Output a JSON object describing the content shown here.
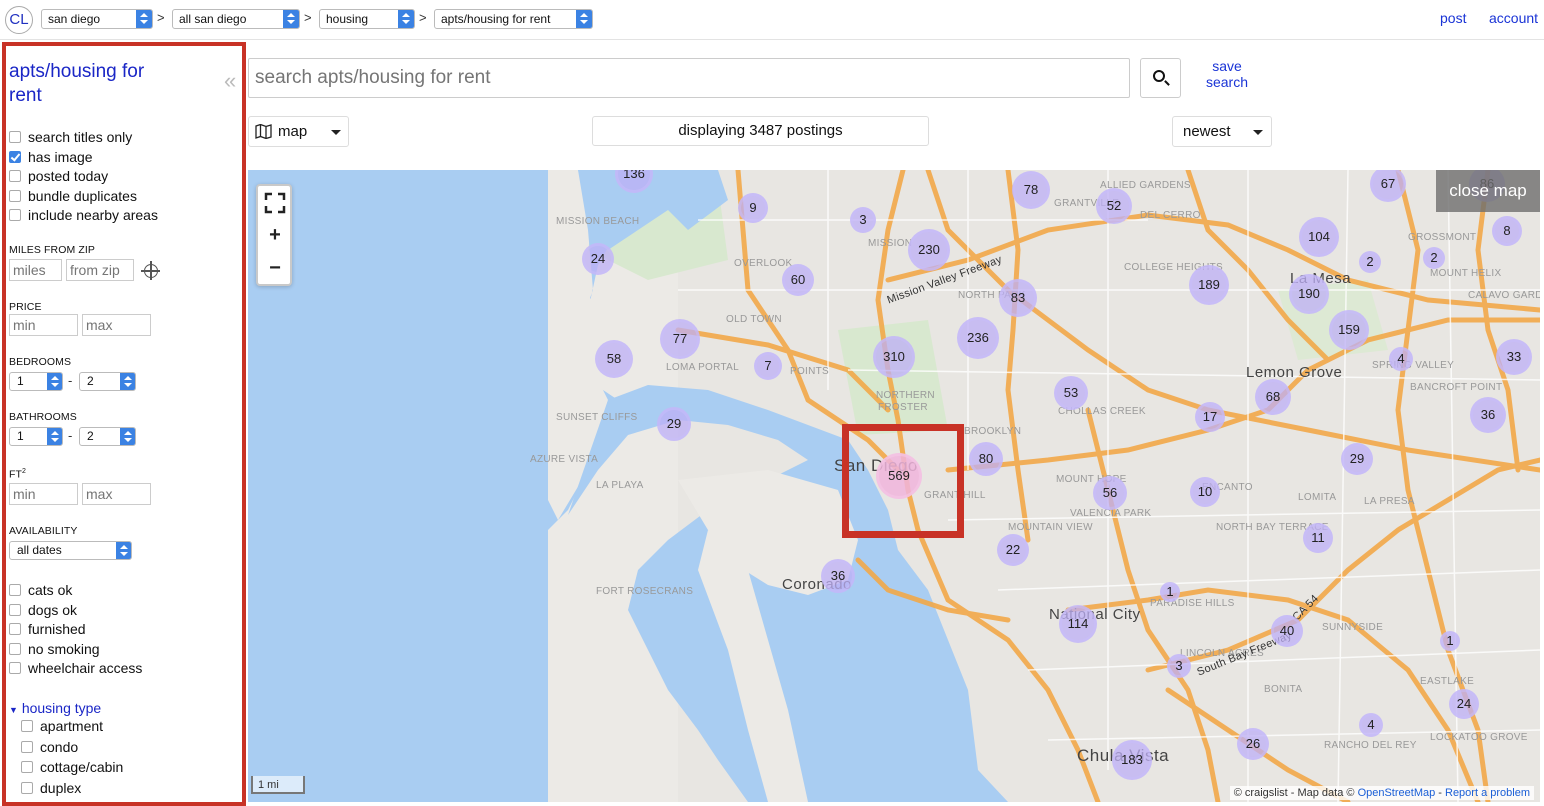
{
  "topbar": {
    "logo": "CL",
    "breadcrumbs": [
      "san diego",
      "all san diego",
      "housing",
      "apts/housing for rent"
    ],
    "separator": ">",
    "post_link": "post",
    "account_link": "account"
  },
  "sidebar": {
    "title": "apts/housing for rent",
    "collapse_glyph": "«",
    "options": [
      {
        "label": "search titles only",
        "checked": false
      },
      {
        "label": "has image",
        "checked": true
      },
      {
        "label": "posted today",
        "checked": false
      },
      {
        "label": "bundle duplicates",
        "checked": false
      },
      {
        "label": "include nearby areas",
        "checked": false
      }
    ],
    "miles_from_zip": {
      "label": "MILES FROM ZIP",
      "miles_placeholder": "miles",
      "zip_placeholder": "from zip"
    },
    "price": {
      "label": "PRICE",
      "min_placeholder": "min",
      "max_placeholder": "max"
    },
    "bedrooms": {
      "label": "BEDROOMS",
      "min": "1",
      "max": "2"
    },
    "bathrooms": {
      "label": "BATHROOMS",
      "min": "1",
      "max": "2"
    },
    "sqft": {
      "label": "FT",
      "sup": "2",
      "min_placeholder": "min",
      "max_placeholder": "max"
    },
    "availability": {
      "label": "AVAILABILITY",
      "value": "all dates"
    },
    "range_dash": "-",
    "amenities": [
      {
        "label": "cats ok",
        "checked": false
      },
      {
        "label": "dogs ok",
        "checked": false
      },
      {
        "label": "furnished",
        "checked": false
      },
      {
        "label": "no smoking",
        "checked": false
      },
      {
        "label": "wheelchair access",
        "checked": false
      }
    ],
    "housing_type": {
      "label": "housing type",
      "items": [
        "apartment",
        "condo",
        "cottage/cabin",
        "duplex"
      ]
    }
  },
  "search": {
    "placeholder": "search apts/housing for rent",
    "save_line1": "save",
    "save_line2": "search"
  },
  "toolbar": {
    "view_mode": "map",
    "postings_text": "displaying 3487 postings",
    "sort": "newest"
  },
  "map": {
    "close_label": "close map",
    "zoom_in": "+",
    "zoom_out": "−",
    "scale": "1 mi",
    "attribution_prefix": "© craigslist - Map data ©",
    "attribution_osm": "OpenStreetMap",
    "attribution_sep": " - ",
    "attribution_report": "Report a problem",
    "clusters": [
      {
        "label": "136",
        "hot": false
      },
      {
        "label": "9",
        "hot": false
      },
      {
        "label": "3",
        "hot": false
      },
      {
        "label": "78",
        "hot": false
      },
      {
        "label": "52",
        "hot": false
      },
      {
        "label": "67",
        "hot": false
      },
      {
        "label": "8",
        "hot": false
      },
      {
        "label": "24",
        "hot": false
      },
      {
        "label": "230",
        "hot": false
      },
      {
        "label": "104",
        "hot": false
      },
      {
        "label": "2",
        "hot": false
      },
      {
        "label": "2",
        "hot": false
      },
      {
        "label": "60",
        "hot": false
      },
      {
        "label": "189",
        "hot": false
      },
      {
        "label": "190",
        "hot": false
      },
      {
        "label": "83",
        "hot": false
      },
      {
        "label": "77",
        "hot": false
      },
      {
        "label": "236",
        "hot": false
      },
      {
        "label": "159",
        "hot": false
      },
      {
        "label": "58",
        "hot": false
      },
      {
        "label": "7",
        "hot": false
      },
      {
        "label": "310",
        "hot": false
      },
      {
        "label": "4",
        "hot": false
      },
      {
        "label": "33",
        "hot": false
      },
      {
        "label": "53",
        "hot": false
      },
      {
        "label": "68",
        "hot": false
      },
      {
        "label": "29",
        "hot": false
      },
      {
        "label": "17",
        "hot": false
      },
      {
        "label": "36",
        "hot": false
      },
      {
        "label": "80",
        "hot": false
      },
      {
        "label": "569",
        "hot": true
      },
      {
        "label": "29",
        "hot": false
      },
      {
        "label": "56",
        "hot": false
      },
      {
        "label": "10",
        "hot": false
      },
      {
        "label": "11",
        "hot": false
      },
      {
        "label": "22",
        "hot": false
      },
      {
        "label": "36",
        "hot": false
      },
      {
        "label": "1",
        "hot": false
      },
      {
        "label": "114",
        "hot": false
      },
      {
        "label": "40",
        "hot": false
      },
      {
        "label": "1",
        "hot": false
      },
      {
        "label": "3",
        "hot": false
      },
      {
        "label": "24",
        "hot": false
      },
      {
        "label": "4",
        "hot": false
      },
      {
        "label": "26",
        "hot": false
      },
      {
        "label": "183",
        "hot": false
      },
      {
        "label": "86",
        "hot": false
      }
    ],
    "place_labels": [
      {
        "text": "San Diego",
        "kind": "city big"
      },
      {
        "text": "Coronado",
        "kind": "city"
      },
      {
        "text": "National City",
        "kind": "city"
      },
      {
        "text": "La Mesa",
        "kind": "city"
      },
      {
        "text": "Lemon Grove",
        "kind": "city"
      },
      {
        "text": "Chula Vista",
        "kind": "city big"
      },
      {
        "text": "MISSION BEACH",
        "kind": ""
      },
      {
        "text": "OVERLOOK",
        "kind": ""
      },
      {
        "text": "OLD TOWN",
        "kind": ""
      },
      {
        "text": "LOMA PORTAL",
        "kind": ""
      },
      {
        "text": "SUNSET CLIFFS",
        "kind": ""
      },
      {
        "text": "AZURE VISTA",
        "kind": ""
      },
      {
        "text": "LA PLAYA",
        "kind": ""
      },
      {
        "text": "FORT ROSECRANS",
        "kind": ""
      },
      {
        "text": "NORTH PARK",
        "kind": ""
      },
      {
        "text": "NORTHERN",
        "kind": ""
      },
      {
        "text": "ALLIED GARDENS",
        "kind": ""
      },
      {
        "text": "GRANTVILLE",
        "kind": ""
      },
      {
        "text": "DEL CERRO",
        "kind": ""
      },
      {
        "text": "COLLEGE HEIGHTS",
        "kind": ""
      },
      {
        "text": "CHOLLAS CREEK",
        "kind": ""
      },
      {
        "text": "MOUNTAIN VIEW",
        "kind": ""
      },
      {
        "text": "VALENCIA PARK",
        "kind": ""
      },
      {
        "text": "PARADISE HILLS",
        "kind": ""
      },
      {
        "text": "BONITA",
        "kind": ""
      },
      {
        "text": "LA PRESA",
        "kind": ""
      },
      {
        "text": "SPRING VALLEY",
        "kind": ""
      },
      {
        "text": "MOUNT HELIX",
        "kind": ""
      },
      {
        "text": "CALAVO GARDENS",
        "kind": ""
      },
      {
        "text": "BANCROFT POINT",
        "kind": ""
      },
      {
        "text": "NORTH BAY TERRACE",
        "kind": ""
      },
      {
        "text": "EASTLAKE",
        "kind": ""
      },
      {
        "text": "RANCHO DEL REY",
        "kind": ""
      },
      {
        "text": "LOCKATOO GROVE",
        "kind": ""
      },
      {
        "text": "MISSION",
        "kind": ""
      },
      {
        "text": "POINTS",
        "kind": ""
      },
      {
        "text": "FROSTER",
        "kind": ""
      },
      {
        "text": "BROOKLYN",
        "kind": ""
      },
      {
        "text": "GRANT HILL",
        "kind": ""
      },
      {
        "text": "LOMITA",
        "kind": ""
      },
      {
        "text": "SUNNYSIDE",
        "kind": ""
      },
      {
        "text": "LINCOLN ACRES",
        "kind": ""
      },
      {
        "text": "GROSSMONT",
        "kind": ""
      },
      {
        "text": "MOUNT HOPE",
        "kind": ""
      },
      {
        "text": "ENCANTO",
        "kind": ""
      },
      {
        "text": "Mission Valley Freeway",
        "kind": "road"
      },
      {
        "text": "South Bay Freeway",
        "kind": "road"
      },
      {
        "text": "CA 54",
        "kind": "road"
      }
    ]
  },
  "colors": {
    "accent_red": "#c83226",
    "link_blue": "#1a26c6",
    "water": "#a9cdf2",
    "freeway": "#f2a94a"
  }
}
